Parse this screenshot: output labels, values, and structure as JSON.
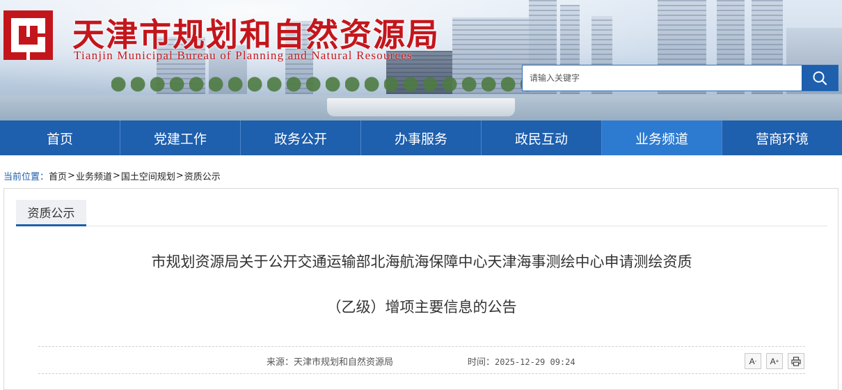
{
  "header": {
    "title_cn": "天津市规划和自然资源局",
    "title_en": "Tianjin Municipal Bureau of Planning and Natural Resources",
    "brand_color": "#c3161c",
    "search": {
      "placeholder": "请输入关键字",
      "button_icon": "search-icon"
    }
  },
  "nav": {
    "items": [
      {
        "label": "首页"
      },
      {
        "label": "党建工作"
      },
      {
        "label": "政务公开"
      },
      {
        "label": "办事服务"
      },
      {
        "label": "政民互动"
      },
      {
        "label": "业务频道",
        "active": true
      },
      {
        "label": "营商环境"
      }
    ],
    "bg_color": "#1e5fae",
    "active_color": "#2d7bd0"
  },
  "breadcrumb": {
    "label": "当前位置：",
    "items": [
      "首页",
      "业务频道",
      "国土空间规划",
      "资质公示"
    ],
    "separator": ">"
  },
  "panel": {
    "tab_label": "资质公示",
    "article": {
      "title_line1": "市规划资源局关于公开交通运输部北海航海保障中心天津海事测绘中心申请测绘资质",
      "title_line2": "（乙级）增项主要信息的公告",
      "source_label": "来源：",
      "source": "天津市规划和自然资源局",
      "time_label": "时间：",
      "time": "2025-12-29 09:24",
      "tools": {
        "font_decrease": "A",
        "font_decrease_mark": "-",
        "font_increase": "A",
        "font_increase_mark": "+",
        "print_icon": "print-icon"
      }
    }
  }
}
